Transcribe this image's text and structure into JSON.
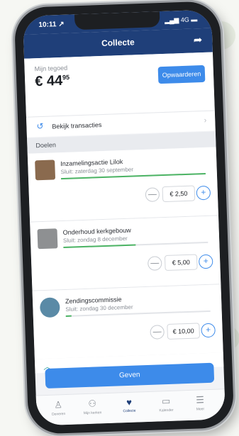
{
  "status_bar": {
    "time": "10:11 ↗",
    "indicators": "▂▄▆ 4G ▬"
  },
  "navbar": {
    "title": "Collecte",
    "share_icon": "share-arrow"
  },
  "tegoed": {
    "label": "Mijn tegoed",
    "amount": "€ 44",
    "amount_cents": "95",
    "button": "Opwaarderen"
  },
  "transactions_link": {
    "label": "Bekijk transacties"
  },
  "section_header": "Doelen",
  "goals": [
    {
      "name": "Inzamelingsactie Lilok",
      "closing": "Sluit: zaterdag 30 september",
      "progress": 1.0,
      "amount": "€ 2,50",
      "thumb_color": "#8a6a4e"
    },
    {
      "name": "Onderhoud kerkgebouw",
      "closing": "Sluit: zondag 8 december",
      "progress": 0.5,
      "amount": "€ 5,00",
      "thumb_color": "#8e9092"
    },
    {
      "name": "Zendingscommissie",
      "closing": "Sluit: zondag 30 december",
      "progress": 0.04,
      "amount": "€ 10,00",
      "thumb_color": "#5a8aa6"
    }
  ],
  "stepper": {
    "minus": "—",
    "plus": "+"
  },
  "more_row_icon": "chevron-up",
  "give_button": "Geven",
  "tabs": [
    {
      "icon": "♙",
      "label": "Doneren"
    },
    {
      "icon": "⚇",
      "label": "Mijn kerken"
    },
    {
      "icon": "♥",
      "label": "Collecte"
    },
    {
      "icon": "▭",
      "label": "Kalender"
    },
    {
      "icon": "☰",
      "label": "Meer"
    }
  ]
}
